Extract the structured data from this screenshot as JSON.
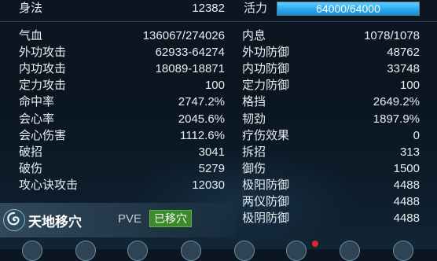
{
  "top_left": {
    "label": "身法",
    "value": "12382"
  },
  "vitality": {
    "label": "活力",
    "text": "64000/64000",
    "fraction": 1.0
  },
  "left_stats": [
    {
      "label": "气血",
      "value": "136067/274026"
    },
    {
      "label": "外功攻击",
      "value": "62933-64274"
    },
    {
      "label": "内功攻击",
      "value": "18089-18871"
    },
    {
      "label": "定力攻击",
      "value": "100"
    },
    {
      "label": "命中率",
      "value": "2747.2%"
    },
    {
      "label": "会心率",
      "value": "2045.6%"
    },
    {
      "label": "会心伤害",
      "value": "1112.6%"
    },
    {
      "label": "破招",
      "value": "3041"
    },
    {
      "label": "破伤",
      "value": "5279"
    },
    {
      "label": "攻心诀攻击",
      "value": "12030"
    }
  ],
  "right_stats": [
    {
      "label": "内息",
      "value": "1078/1078"
    },
    {
      "label": "外功防御",
      "value": "48762"
    },
    {
      "label": "内功防御",
      "value": "33748"
    },
    {
      "label": "定力防御",
      "value": "100"
    },
    {
      "label": "格挡",
      "value": "2649.2%"
    },
    {
      "label": "韧劲",
      "value": "1897.9%"
    },
    {
      "label": "疗伤效果",
      "value": "0"
    },
    {
      "label": "拆招",
      "value": "313"
    },
    {
      "label": "御伤",
      "value": "1500"
    },
    {
      "label": "极阳防御",
      "value": "4488"
    },
    {
      "label": "两仪防御",
      "value": "4488"
    },
    {
      "label": "极阴防御",
      "value": "4488"
    }
  ],
  "travel": {
    "icon": "swirl-icon",
    "name": "天地移穴",
    "mode": "PVE",
    "status": "已移穴"
  },
  "colors": {
    "vitality_fill": "#2aa8ee",
    "moved_badge": "#3b8a2c",
    "notify_dot": "#e0262e"
  }
}
